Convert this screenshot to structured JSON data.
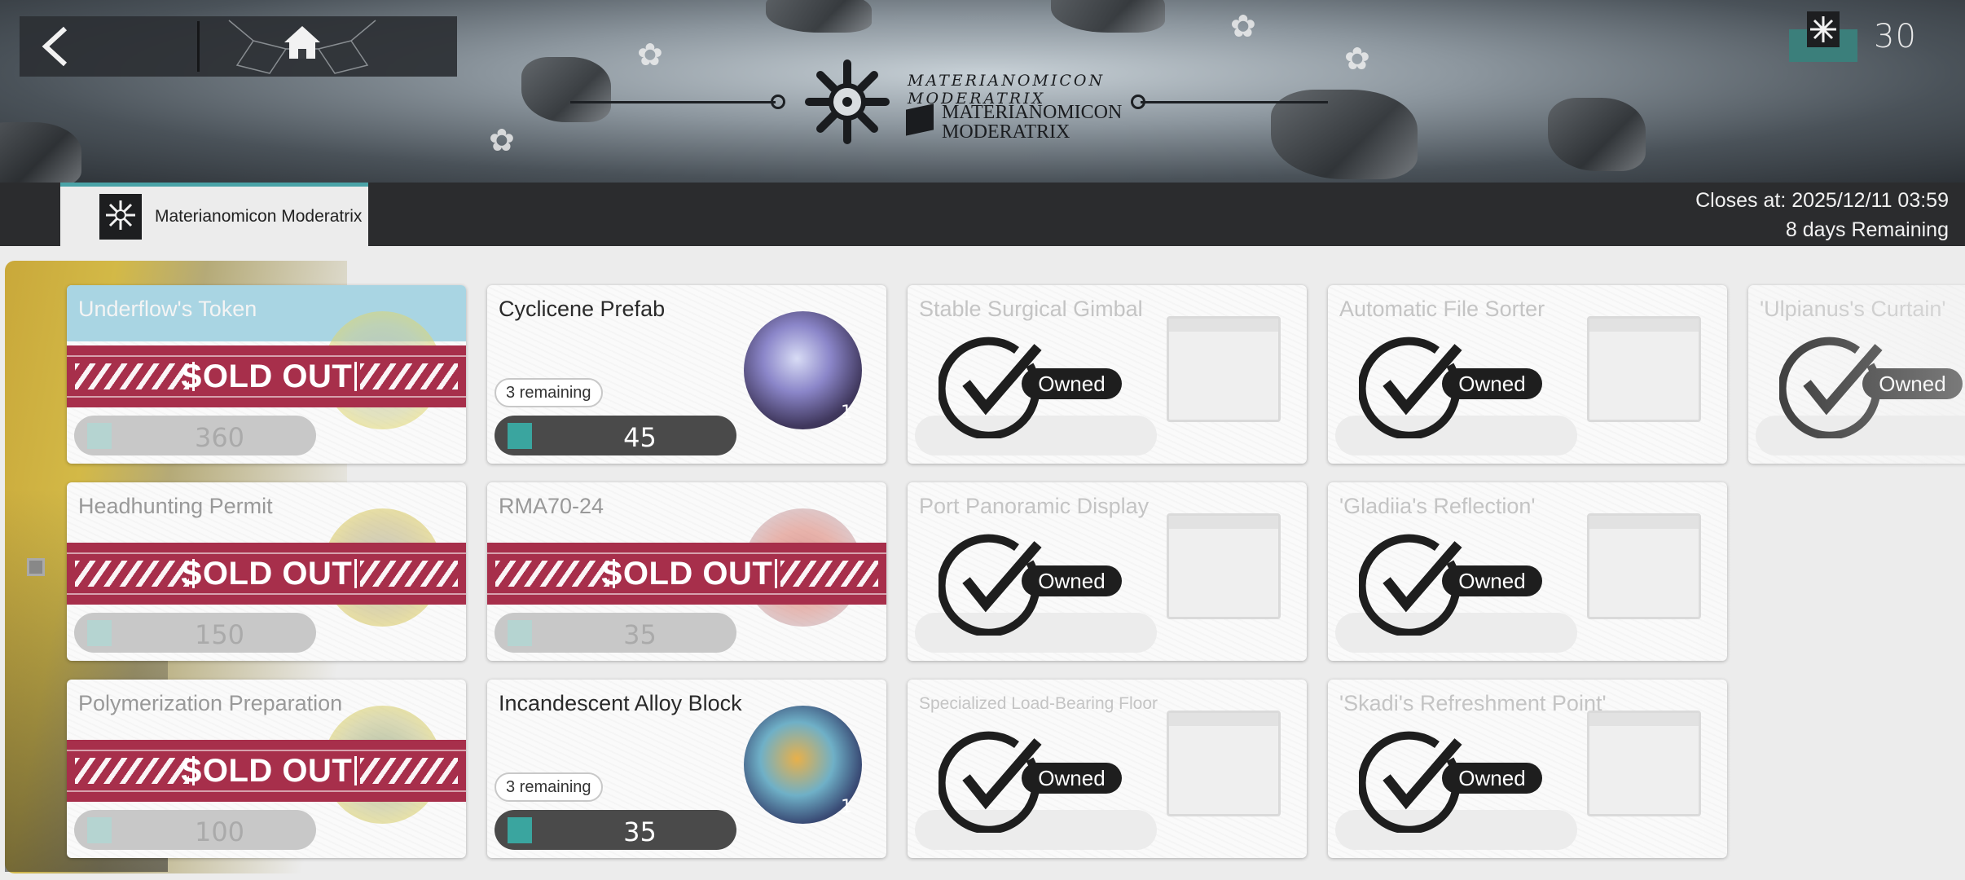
{
  "banner": {
    "logo_script": "MATERIANOMICON MODERATRIX",
    "logo_title_line1": "MATERIANOMICON",
    "logo_title_line2": "MODERATRIX"
  },
  "nav": {
    "back_icon": "chevron-left-icon",
    "home_icon": "home-icon"
  },
  "currency": {
    "icon": "materianomicon-token-icon",
    "amount": "30"
  },
  "shop_tab": {
    "label": "Materianomicon Moderatrix",
    "accent": "#4aa3a7"
  },
  "schedule": {
    "closes_at": "Closes at: 2025/12/11 03:59",
    "remaining": "8 days Remaining"
  },
  "labels": {
    "sold_out": "SOLD OUT",
    "owned": "Owned"
  },
  "colors": {
    "sold_out_band": "#a72f4b",
    "price_bar": "#4a4a4a",
    "token_teal": "#3aa59f"
  },
  "items": [
    {
      "name": "Underflow's Token",
      "price": "360",
      "status": "sold_out",
      "thumb": "token"
    },
    {
      "name": "Cyclicene Prefab",
      "price": "45",
      "status": "available",
      "remaining": "3 remaining",
      "quantity": "1",
      "thumb": "crystal"
    },
    {
      "name": "Stable Surgical Gimbal",
      "price": "",
      "status": "owned"
    },
    {
      "name": "Automatic File Sorter",
      "price": "",
      "status": "owned"
    },
    {
      "name": "'Ulpianus's Curtain'",
      "price": "",
      "status": "owned"
    },
    {
      "name": "Headhunting Permit",
      "price": "150",
      "status": "sold_out",
      "thumb": "permit"
    },
    {
      "name": "RMA70-24",
      "price": "35",
      "status": "sold_out",
      "thumb": "rma"
    },
    {
      "name": "Port Panoramic Display",
      "price": "",
      "status": "owned"
    },
    {
      "name": "'Gladiia's Reflection'",
      "price": "",
      "status": "owned"
    },
    {
      "name": "Polymerization Preparation",
      "price": "100",
      "status": "sold_out",
      "thumb": "poly"
    },
    {
      "name": "Incandescent Alloy Block",
      "price": "35",
      "status": "available",
      "remaining": "3 remaining",
      "quantity": "1",
      "thumb": "alloy"
    },
    {
      "name": "Specialized Load-Bearing Floor",
      "price": "",
      "status": "owned"
    },
    {
      "name": "'Skadi's Refreshment Point'",
      "price": "",
      "status": "owned"
    }
  ]
}
